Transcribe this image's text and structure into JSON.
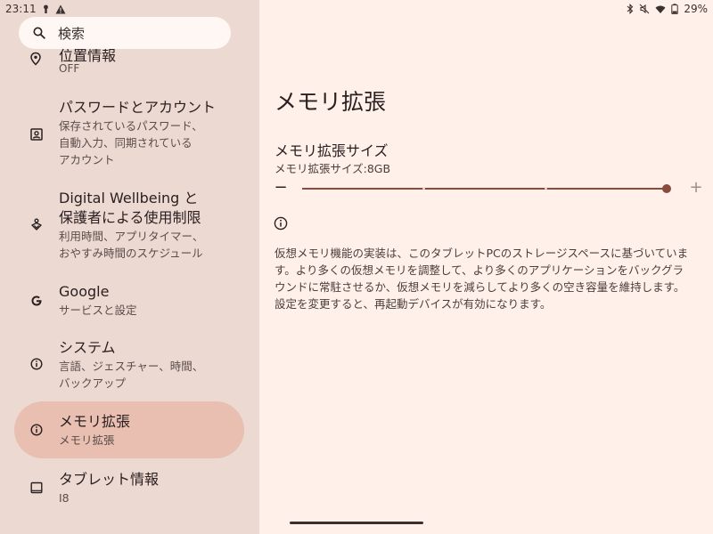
{
  "status": {
    "time": "23:11",
    "battery": "29%"
  },
  "search": {
    "label": "検索"
  },
  "sidebar": {
    "partial_item": {
      "title": "位置情報",
      "subtitle": "OFF"
    },
    "items": [
      {
        "title": "パスワードとアカウント",
        "sub": [
          "保存されているパスワード、",
          "自動入力、同期されている",
          "アカウント"
        ],
        "icon": "account-box-icon"
      },
      {
        "title": "Digital Wellbeing と",
        "title2": "保護者による使用制限",
        "sub": [
          "利用時間、アプリタイマー、",
          "おやすみ時間のスケジュール"
        ],
        "icon": "wellbeing-icon"
      },
      {
        "title": "Google",
        "sub": [
          "サービスと設定"
        ],
        "icon": "google-icon"
      },
      {
        "title": "システム",
        "sub": [
          "言語、ジェスチャー、時間、",
          "バックアップ"
        ],
        "icon": "info-icon"
      },
      {
        "title": "メモリ拡張",
        "sub": [
          "メモリ拡張"
        ],
        "icon": "info-icon"
      },
      {
        "title": "タブレット情報",
        "sub": [
          "I8"
        ],
        "icon": "tablet-icon"
      }
    ]
  },
  "main": {
    "page_title": "メモリ拡張",
    "section_title": "メモリ拡張サイズ",
    "section_sub": "メモリ拡張サイズ:8GB",
    "slider": {
      "minus_label": "−",
      "plus_label": "+",
      "value_fraction": 1.0,
      "steps": 4
    },
    "description": "仮想メモリ機能の実装は、このタブレットPCのストレージスペースに基づいています。より多くの仮想メモリを調整して、より多くのアプリケーションをバックグラウンドに常駐させるか、仮想メモリを減らしてより多くの空き容量を維持します。設定を変更すると、再起動デバイスが有効になります。"
  },
  "colors": {
    "accent": "#8a4b3c",
    "active_bg": "#e8bfb1",
    "sidebar_bg": "#ecd9d2",
    "main_bg": "#fff0ea"
  }
}
